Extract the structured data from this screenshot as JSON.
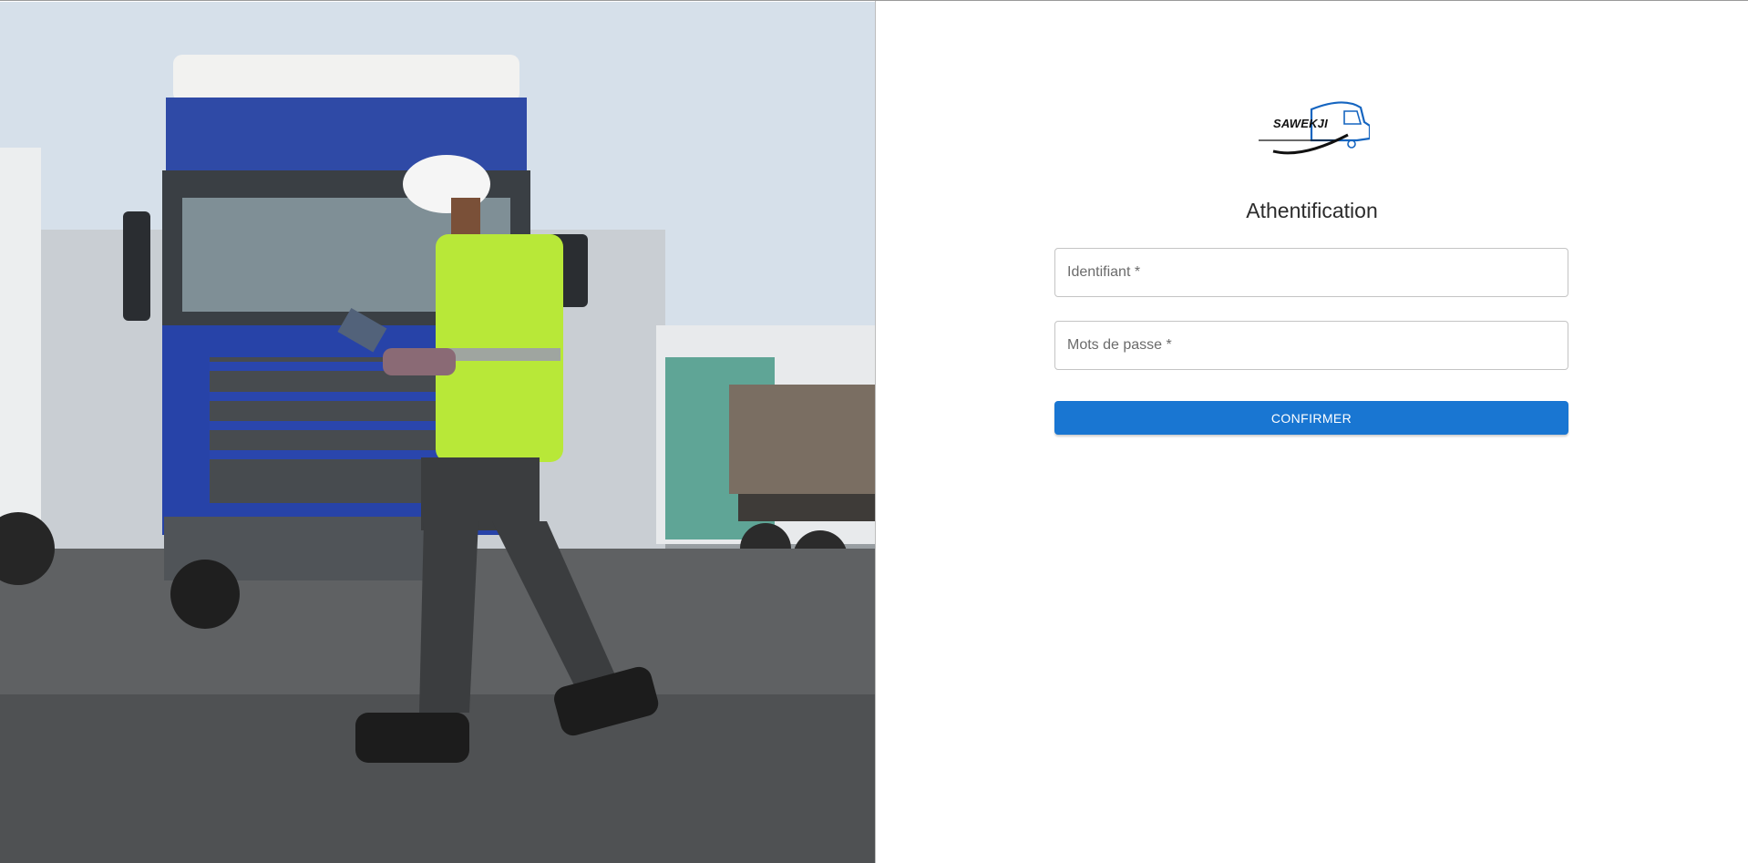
{
  "brand": {
    "logo_text": "SAWEKJI"
  },
  "login": {
    "title": "Athentification",
    "username_label": "Identifiant *",
    "password_label": "Mots de passe *",
    "submit_label": "CONFIRMER"
  },
  "colors": {
    "primary": "#1976d2",
    "field_border": "#c4c4c4",
    "label": "#6b6b6b"
  }
}
